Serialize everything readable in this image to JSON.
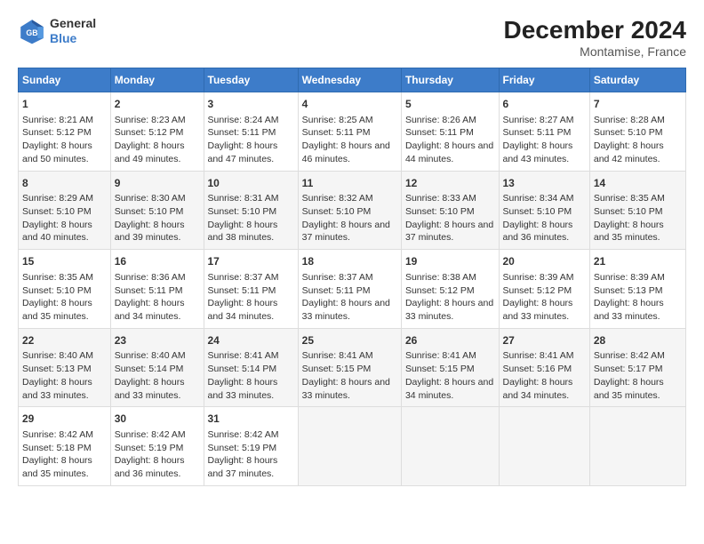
{
  "header": {
    "title": "December 2024",
    "subtitle": "Montamise, France",
    "logo_general": "General",
    "logo_blue": "Blue"
  },
  "days_of_week": [
    "Sunday",
    "Monday",
    "Tuesday",
    "Wednesday",
    "Thursday",
    "Friday",
    "Saturday"
  ],
  "weeks": [
    [
      {
        "day": "1",
        "sunrise": "Sunrise: 8:21 AM",
        "sunset": "Sunset: 5:12 PM",
        "daylight": "Daylight: 8 hours and 50 minutes."
      },
      {
        "day": "2",
        "sunrise": "Sunrise: 8:23 AM",
        "sunset": "Sunset: 5:12 PM",
        "daylight": "Daylight: 8 hours and 49 minutes."
      },
      {
        "day": "3",
        "sunrise": "Sunrise: 8:24 AM",
        "sunset": "Sunset: 5:11 PM",
        "daylight": "Daylight: 8 hours and 47 minutes."
      },
      {
        "day": "4",
        "sunrise": "Sunrise: 8:25 AM",
        "sunset": "Sunset: 5:11 PM",
        "daylight": "Daylight: 8 hours and 46 minutes."
      },
      {
        "day": "5",
        "sunrise": "Sunrise: 8:26 AM",
        "sunset": "Sunset: 5:11 PM",
        "daylight": "Daylight: 8 hours and 44 minutes."
      },
      {
        "day": "6",
        "sunrise": "Sunrise: 8:27 AM",
        "sunset": "Sunset: 5:11 PM",
        "daylight": "Daylight: 8 hours and 43 minutes."
      },
      {
        "day": "7",
        "sunrise": "Sunrise: 8:28 AM",
        "sunset": "Sunset: 5:10 PM",
        "daylight": "Daylight: 8 hours and 42 minutes."
      }
    ],
    [
      {
        "day": "8",
        "sunrise": "Sunrise: 8:29 AM",
        "sunset": "Sunset: 5:10 PM",
        "daylight": "Daylight: 8 hours and 40 minutes."
      },
      {
        "day": "9",
        "sunrise": "Sunrise: 8:30 AM",
        "sunset": "Sunset: 5:10 PM",
        "daylight": "Daylight: 8 hours and 39 minutes."
      },
      {
        "day": "10",
        "sunrise": "Sunrise: 8:31 AM",
        "sunset": "Sunset: 5:10 PM",
        "daylight": "Daylight: 8 hours and 38 minutes."
      },
      {
        "day": "11",
        "sunrise": "Sunrise: 8:32 AM",
        "sunset": "Sunset: 5:10 PM",
        "daylight": "Daylight: 8 hours and 37 minutes."
      },
      {
        "day": "12",
        "sunrise": "Sunrise: 8:33 AM",
        "sunset": "Sunset: 5:10 PM",
        "daylight": "Daylight: 8 hours and 37 minutes."
      },
      {
        "day": "13",
        "sunrise": "Sunrise: 8:34 AM",
        "sunset": "Sunset: 5:10 PM",
        "daylight": "Daylight: 8 hours and 36 minutes."
      },
      {
        "day": "14",
        "sunrise": "Sunrise: 8:35 AM",
        "sunset": "Sunset: 5:10 PM",
        "daylight": "Daylight: 8 hours and 35 minutes."
      }
    ],
    [
      {
        "day": "15",
        "sunrise": "Sunrise: 8:35 AM",
        "sunset": "Sunset: 5:10 PM",
        "daylight": "Daylight: 8 hours and 35 minutes."
      },
      {
        "day": "16",
        "sunrise": "Sunrise: 8:36 AM",
        "sunset": "Sunset: 5:11 PM",
        "daylight": "Daylight: 8 hours and 34 minutes."
      },
      {
        "day": "17",
        "sunrise": "Sunrise: 8:37 AM",
        "sunset": "Sunset: 5:11 PM",
        "daylight": "Daylight: 8 hours and 34 minutes."
      },
      {
        "day": "18",
        "sunrise": "Sunrise: 8:37 AM",
        "sunset": "Sunset: 5:11 PM",
        "daylight": "Daylight: 8 hours and 33 minutes."
      },
      {
        "day": "19",
        "sunrise": "Sunrise: 8:38 AM",
        "sunset": "Sunset: 5:12 PM",
        "daylight": "Daylight: 8 hours and 33 minutes."
      },
      {
        "day": "20",
        "sunrise": "Sunrise: 8:39 AM",
        "sunset": "Sunset: 5:12 PM",
        "daylight": "Daylight: 8 hours and 33 minutes."
      },
      {
        "day": "21",
        "sunrise": "Sunrise: 8:39 AM",
        "sunset": "Sunset: 5:13 PM",
        "daylight": "Daylight: 8 hours and 33 minutes."
      }
    ],
    [
      {
        "day": "22",
        "sunrise": "Sunrise: 8:40 AM",
        "sunset": "Sunset: 5:13 PM",
        "daylight": "Daylight: 8 hours and 33 minutes."
      },
      {
        "day": "23",
        "sunrise": "Sunrise: 8:40 AM",
        "sunset": "Sunset: 5:14 PM",
        "daylight": "Daylight: 8 hours and 33 minutes."
      },
      {
        "day": "24",
        "sunrise": "Sunrise: 8:41 AM",
        "sunset": "Sunset: 5:14 PM",
        "daylight": "Daylight: 8 hours and 33 minutes."
      },
      {
        "day": "25",
        "sunrise": "Sunrise: 8:41 AM",
        "sunset": "Sunset: 5:15 PM",
        "daylight": "Daylight: 8 hours and 33 minutes."
      },
      {
        "day": "26",
        "sunrise": "Sunrise: 8:41 AM",
        "sunset": "Sunset: 5:15 PM",
        "daylight": "Daylight: 8 hours and 34 minutes."
      },
      {
        "day": "27",
        "sunrise": "Sunrise: 8:41 AM",
        "sunset": "Sunset: 5:16 PM",
        "daylight": "Daylight: 8 hours and 34 minutes."
      },
      {
        "day": "28",
        "sunrise": "Sunrise: 8:42 AM",
        "sunset": "Sunset: 5:17 PM",
        "daylight": "Daylight: 8 hours and 35 minutes."
      }
    ],
    [
      {
        "day": "29",
        "sunrise": "Sunrise: 8:42 AM",
        "sunset": "Sunset: 5:18 PM",
        "daylight": "Daylight: 8 hours and 35 minutes."
      },
      {
        "day": "30",
        "sunrise": "Sunrise: 8:42 AM",
        "sunset": "Sunset: 5:19 PM",
        "daylight": "Daylight: 8 hours and 36 minutes."
      },
      {
        "day": "31",
        "sunrise": "Sunrise: 8:42 AM",
        "sunset": "Sunset: 5:19 PM",
        "daylight": "Daylight: 8 hours and 37 minutes."
      },
      null,
      null,
      null,
      null
    ]
  ]
}
